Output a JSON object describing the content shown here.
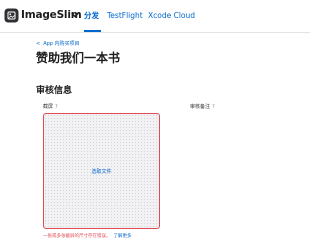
{
  "header": {
    "app_name": "ImageSlim",
    "logo_icon": "image-slim-logo-icon",
    "tabs": [
      {
        "label": "分发",
        "active": true
      },
      {
        "label": "TestFlight",
        "active": false
      },
      {
        "label": "Xcode Cloud",
        "active": false
      }
    ]
  },
  "breadcrumb": {
    "back_label": "App 内购买项目"
  },
  "page": {
    "title": "赞助我们一本书"
  },
  "review_section": {
    "title": "审核信息",
    "screenshot_label": "截屏",
    "notes_label": "审核备注",
    "help_symbol": "?",
    "upload_label": "选取文件",
    "error_text": "一张或多张截屏的尺寸存在错误。",
    "learn_more": "了解更多"
  },
  "colors": {
    "accent": "#0066cc",
    "error": "#e04b55"
  }
}
